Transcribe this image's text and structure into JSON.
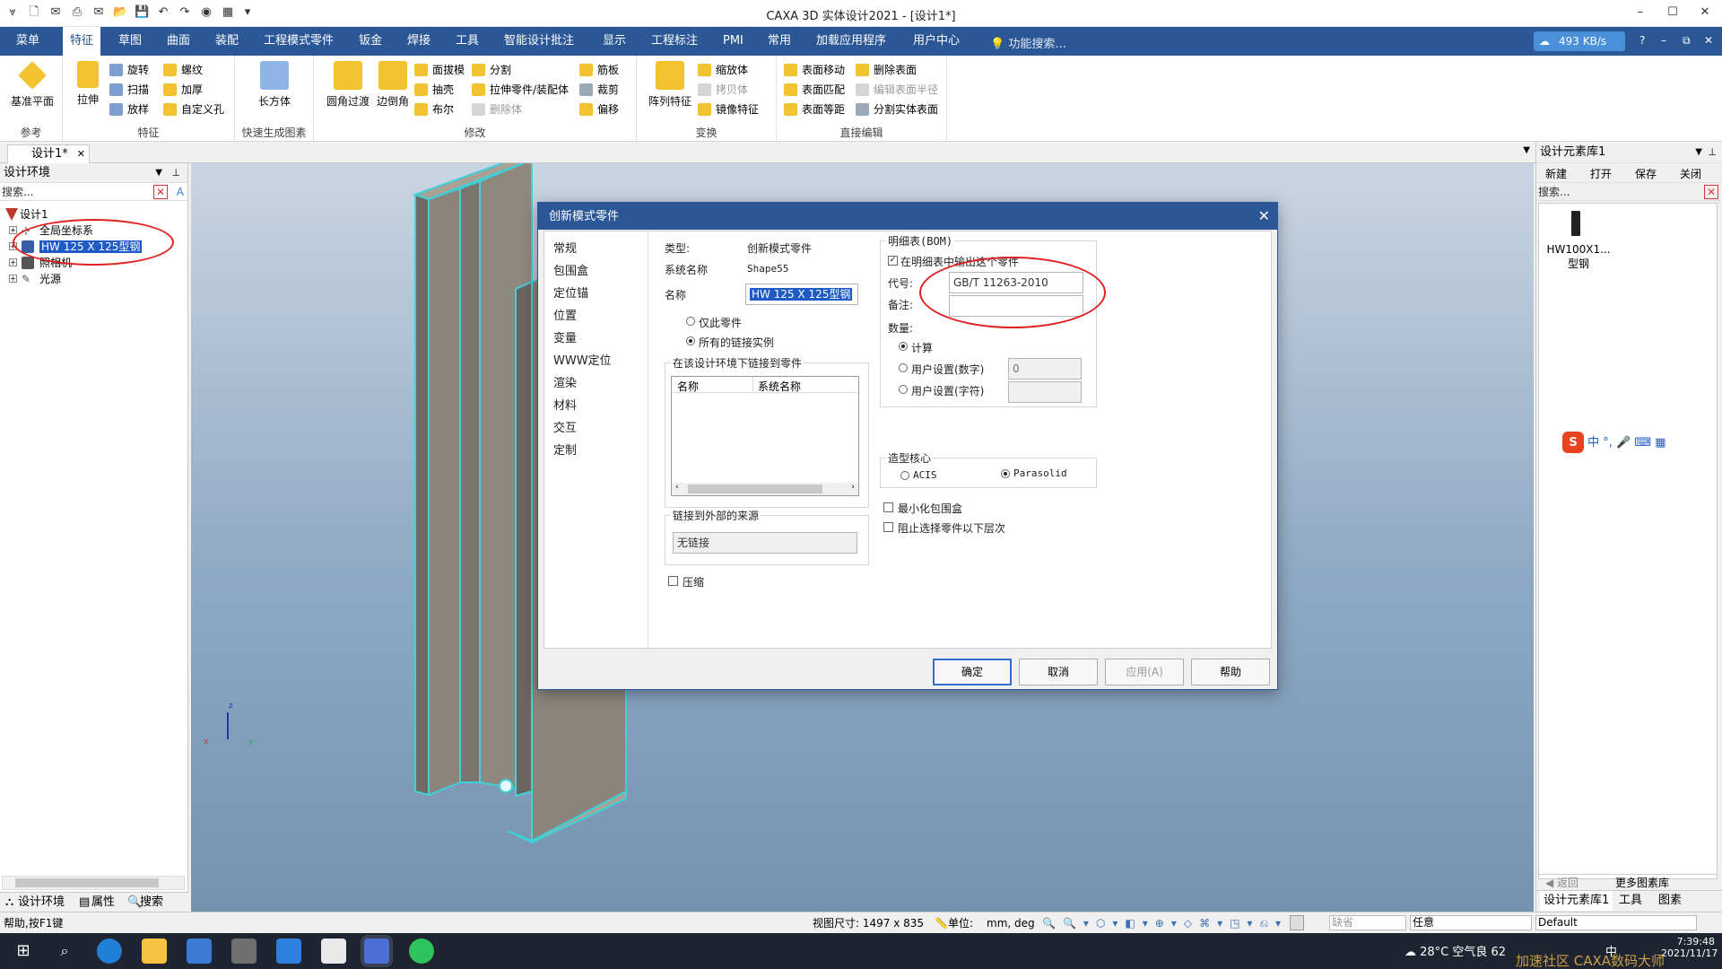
{
  "window": {
    "title": "CAXA 3D 实体设计2021 - [设计1*]",
    "minimize": "–",
    "maximize": "☐",
    "close": "✕"
  },
  "menu_tabs": [
    "菜单",
    "特征",
    "草图",
    "曲面",
    "装配",
    "工程模式零件",
    "钣金",
    "焊接",
    "工具",
    "智能设计批注",
    "显示",
    "工程标注",
    "PMI",
    "常用",
    "加载应用程序",
    "用户中心"
  ],
  "active_tab": "特征",
  "function_search": "功能搜索...",
  "network_speed": "493 KB/s",
  "ribbon": {
    "groups": [
      "参考",
      "特征",
      "快速生成图素",
      "修改",
      "变换",
      "直接编辑"
    ],
    "reference_plane": "基准平面",
    "extrude": "拉伸",
    "feature_small": [
      "旋转",
      "扫描",
      "放样",
      "螺纹",
      "加厚",
      "自定义孔"
    ],
    "box": "长方体",
    "fillet": "圆角过渡",
    "chamfer": "边倒角",
    "modify_small": [
      "面拔模",
      "抽壳",
      "布尔",
      "分割",
      "拉伸零件/装配体",
      "删除体",
      "筋板",
      "裁剪",
      "偏移"
    ],
    "pattern": "阵列特征",
    "transform_small": [
      "缩放体",
      "拷贝体",
      "镜像特征"
    ],
    "direct_edit_small": [
      "表面移动",
      "表面匹配",
      "表面等距",
      "删除表面",
      "编辑表面半径",
      "分割实体表面"
    ]
  },
  "doc_tab": "设计1*",
  "left_panel": {
    "header": "设计环境",
    "search_label": "搜索...",
    "tree": [
      {
        "label": "设计1"
      },
      {
        "label": "全局坐标系"
      },
      {
        "label": "HW 125 X 125型钢"
      },
      {
        "label": "照相机"
      },
      {
        "label": "光源"
      }
    ],
    "bottom_tabs": [
      "设计环境",
      "属性",
      "搜索"
    ]
  },
  "right_panel": {
    "header": "设计元素库1",
    "buttons": [
      "新建",
      "打开",
      "保存",
      "关闭"
    ],
    "search_label": "搜索...",
    "item_label_line1": "HW100X1...",
    "item_label_line2": "型钢",
    "nav_back": "返回",
    "more": "更多图素库",
    "bottom_tabs": [
      "设计元素库1",
      "工具",
      "图素"
    ],
    "ime": "中 °, 🎤 ⌨ ▦"
  },
  "dialog": {
    "title": "创新模式零件",
    "nav": [
      "常规",
      "包围盒",
      "定位锚",
      "位置",
      "变量",
      "WWW定位",
      "渲染",
      "材料",
      "交互",
      "定制"
    ],
    "type_label": "类型:",
    "type_value": "创新模式零件",
    "sysname_label": "系统名称",
    "sysname_value": "Shape55",
    "name_label": "名称",
    "name_value": "HW 125 X 125型钢",
    "only_part": "仅此零件",
    "all_linked": "所有的链接实例",
    "linked_group": "在该设计环境下链接到零件",
    "col_name": "名称",
    "col_sysname": "系统名称",
    "external_group": "链接到外部的来源",
    "no_link": "无链接",
    "compress": "压缩",
    "bom_group": "明细表(BOM)",
    "bom_output": "在明细表中输出这个零件",
    "code_label": "代号:",
    "code_value": "GB/T 11263-2010",
    "remark_label": "备注:",
    "remark_value": "",
    "qty_label": "数量:",
    "qty_calc": "计算",
    "qty_user_num": "用户设置(数字)",
    "qty_user_num_value": "0",
    "qty_user_str": "用户设置(字符)",
    "kernel_group": "造型核心",
    "kernel_acis": "ACIS",
    "kernel_parasolid": "Parasolid",
    "min_bbox": "最小化包围盒",
    "block_below": "阻止选择零件以下层次",
    "ok": "确定",
    "cancel": "取消",
    "apply": "应用(A)",
    "help": "帮助"
  },
  "status": {
    "help": "帮助,按F1键",
    "view_size": "视图尺寸: 1497 x  835",
    "unit_label": "单位:",
    "unit_value": "mm, deg",
    "combo1": "缺省",
    "combo2": "任意",
    "combo3": "Default"
  },
  "taskbar": {
    "weather": "28°C  空气良 62",
    "ime": "中",
    "time": "7:39:48",
    "date": "2021/11/17"
  },
  "watermark": "加速社区  CAXA数码大师",
  "axis": {
    "z": "z",
    "x": "x",
    "y": "y"
  },
  "colors": {
    "accent": "#2b5797",
    "selection": "#1e5bc6",
    "annotation": "#e02020",
    "steel": "#8a847c",
    "edge": "#3fd0d8"
  }
}
